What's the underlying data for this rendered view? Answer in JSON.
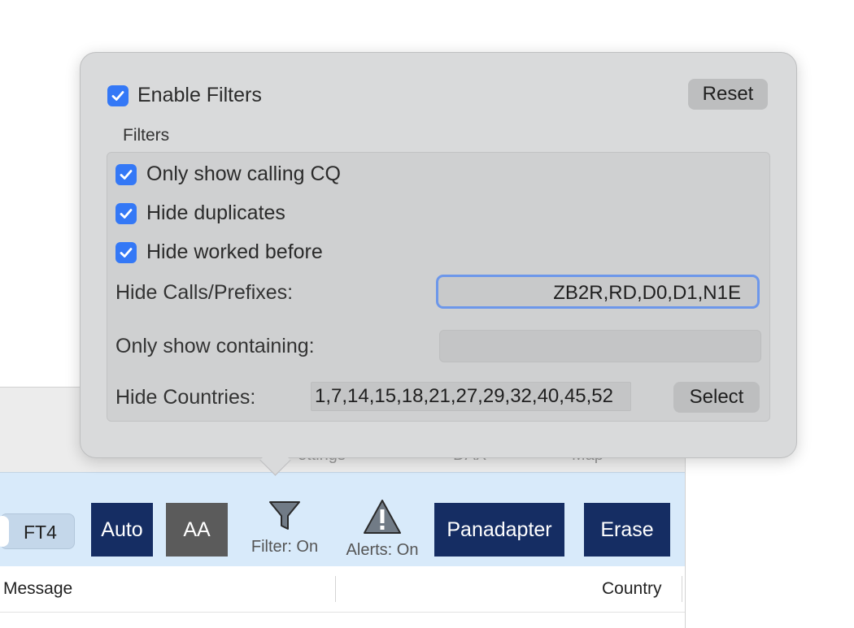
{
  "popover": {
    "enable_filters": {
      "label": "Enable Filters",
      "checked": true
    },
    "reset_label": "Reset",
    "group_title": "Filters",
    "checkboxes": [
      {
        "label": "Only show calling CQ",
        "checked": true
      },
      {
        "label": "Hide duplicates",
        "checked": true
      },
      {
        "label": "Hide worked before",
        "checked": true
      }
    ],
    "hide_calls": {
      "label": "Hide Calls/Prefixes:",
      "value": "ZB2R,RD,D0,D1,N1E"
    },
    "only_show": {
      "label": "Only show containing:",
      "value": ""
    },
    "hide_countries": {
      "label": "Hide Countries:",
      "value": "1,7,14,15,18,21,27,29,32,40,45,52",
      "select_label": "Select"
    }
  },
  "background": {
    "tabs": [
      "ettings",
      "DAX",
      "Map"
    ],
    "toolbar": {
      "mode_label": "FT4",
      "auto_label": "Auto",
      "aa_label": "AA",
      "filter_label": "Filter: On",
      "alerts_label": "Alerts: On",
      "panadapter_label": "Panadapter",
      "erase_label": "Erase"
    },
    "columns": [
      "Message",
      "Country"
    ]
  },
  "colors": {
    "accent": "#3478f6",
    "navy_button": "#152d63",
    "gray_button": "#5b5b5b",
    "toolbar_bg": "#d8eafa"
  }
}
